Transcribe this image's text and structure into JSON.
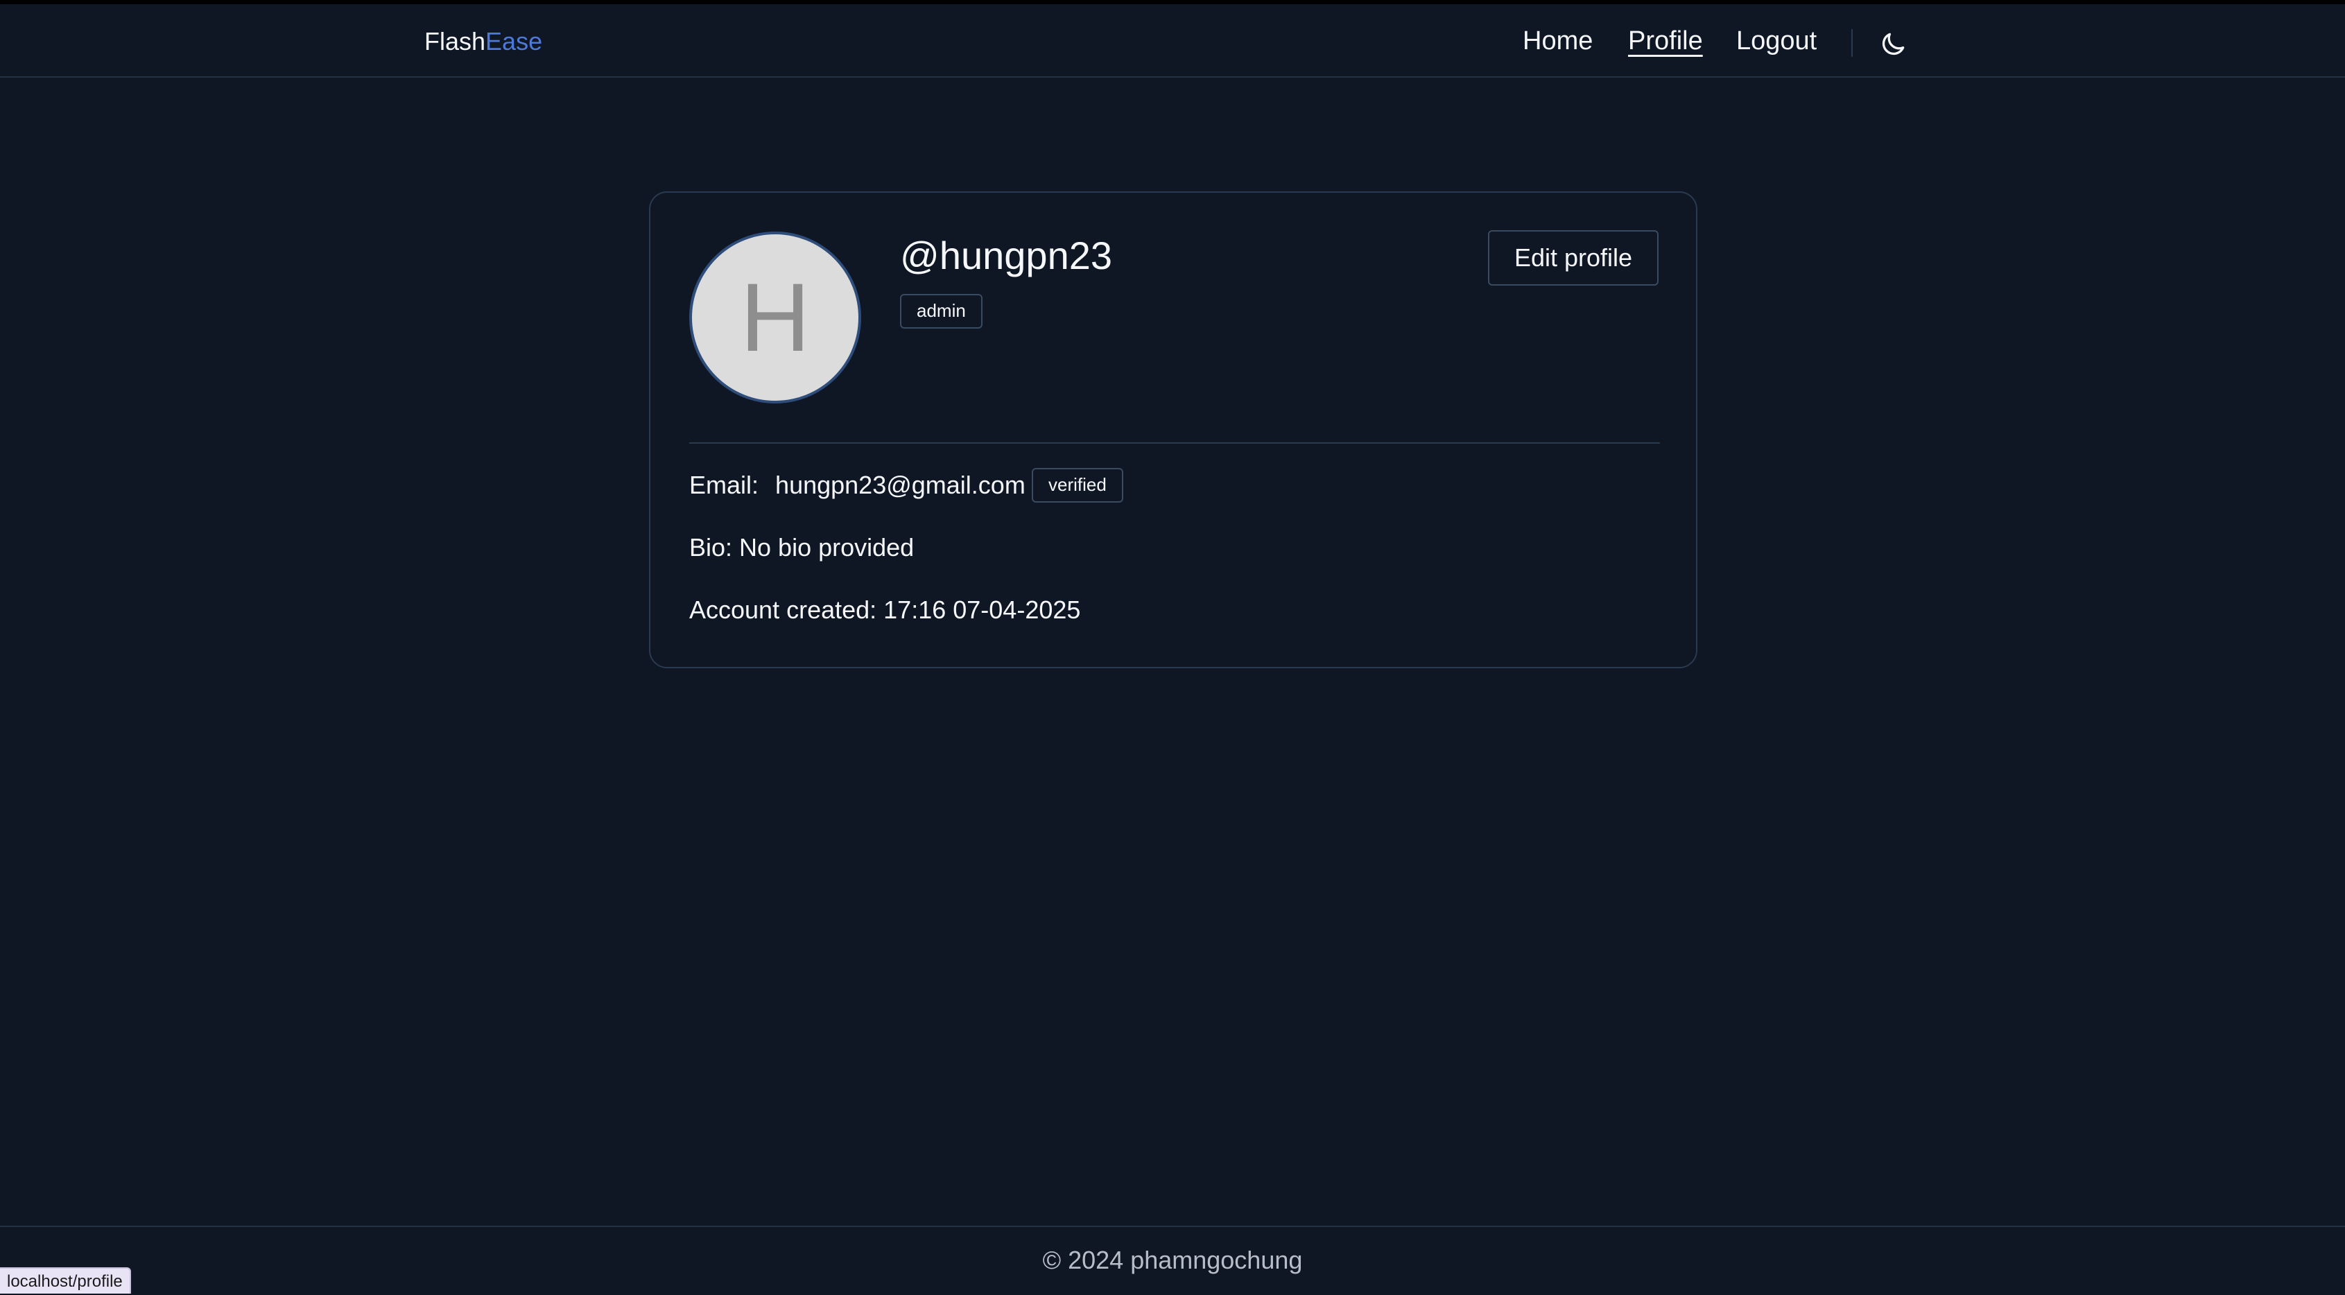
{
  "navbar": {
    "brand_part1": "Flash",
    "brand_part2": "Ease",
    "links": [
      {
        "label": "Home"
      },
      {
        "label": "Profile"
      },
      {
        "label": "Logout"
      }
    ],
    "active_link": "Profile",
    "theme_toggle_icon": "moon-icon"
  },
  "profile": {
    "avatar_initial": "H",
    "username": "@hungpn23",
    "role_badge": "admin",
    "edit_button_label": "Edit profile",
    "email_label": "Email:",
    "email_value": "hungpn23@gmail.com",
    "email_status_badge": "verified",
    "bio_text": "Bio: No bio provided",
    "created_text": "Account created: 17:16 07-04-2025"
  },
  "footer": {
    "copyright": "© 2024 phamngochung"
  },
  "status_bar": {
    "url": "localhost/profile"
  },
  "colors": {
    "background": "#0f1624",
    "brand_accent": "#4d79d8",
    "border": "#2a3a4f",
    "avatar_bg": "#dcdcdc",
    "avatar_ring": "#2f4d7a"
  }
}
